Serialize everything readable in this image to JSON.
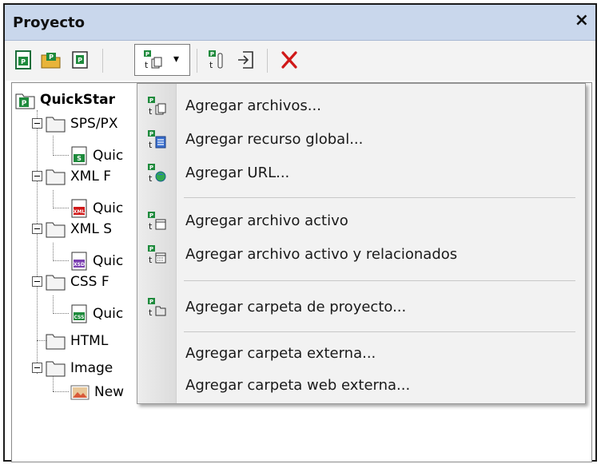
{
  "panel": {
    "title": "Proyecto",
    "close_glyph": "×"
  },
  "toolbar": {
    "buttons": [
      "new-project-icon",
      "open-project-icon",
      "save-project-icon",
      "add-files-dropdown-icon",
      "add-to-project-icon",
      "import-icon",
      "delete-icon"
    ],
    "dropdown_arrow": "▾"
  },
  "tree": {
    "root_label": "QuickStar",
    "items": [
      {
        "label": "SPS/PX"
      },
      {
        "label": "Quic"
      },
      {
        "label": "XML F"
      },
      {
        "label": "Quic"
      },
      {
        "label": "XML S"
      },
      {
        "label": "Quic"
      },
      {
        "label": "CSS F"
      },
      {
        "label": "Quic"
      },
      {
        "label": "HTML"
      },
      {
        "label": "Image"
      },
      {
        "label": "New"
      }
    ]
  },
  "menu": {
    "items": [
      {
        "label": "Agregar archivos..."
      },
      {
        "label": "Agregar recurso global..."
      },
      {
        "label": "Agregar URL..."
      },
      {
        "label": "Agregar archivo activo"
      },
      {
        "label": "Agregar archivo activo y relacionados"
      },
      {
        "label": "Agregar carpeta de proyecto..."
      },
      {
        "label": "Agregar carpeta externa..."
      },
      {
        "label": "Agregar carpeta web externa..."
      }
    ]
  },
  "colors": {
    "titlebar": "#c9d7ec",
    "delete_red": "#d01818",
    "icon_green": "#1e8a3c"
  }
}
